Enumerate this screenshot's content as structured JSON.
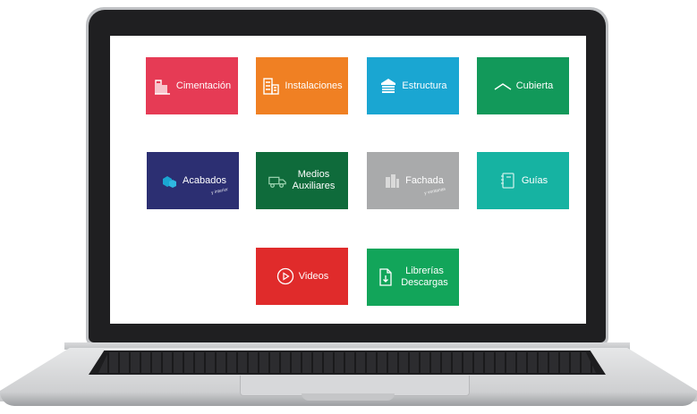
{
  "tiles": [
    {
      "id": "cimentacion",
      "label": "Cimentación",
      "color": "#e63b55",
      "icon": "columns-icon"
    },
    {
      "id": "instalaciones",
      "label": "Instalaciones",
      "color": "#f08023",
      "icon": "building-icon"
    },
    {
      "id": "estructura",
      "label": "Estructura",
      "color": "#1aa6d2",
      "icon": "stack-icon"
    },
    {
      "id": "cubierta",
      "label": "Cubierta",
      "color": "#12995a",
      "icon": "roof-icon"
    },
    {
      "id": "acabados",
      "label": "Acabados",
      "sublabel": "y interior",
      "color": "#2c2f72",
      "icon": "cubes-icon"
    },
    {
      "id": "medios",
      "label": "Medios Auxiliares",
      "color": "#0f6b3b",
      "icon": "truck-icon"
    },
    {
      "id": "fachada",
      "label": "Fachada",
      "sublabel": "y ventanas",
      "color": "#a9aaab",
      "icon": "facade-icon"
    },
    {
      "id": "guias",
      "label": "Guías",
      "color": "#16b3a2",
      "icon": "notebook-icon"
    },
    {
      "id": "videos",
      "label": "Videos",
      "color": "#e02b2b",
      "icon": "play-icon"
    },
    {
      "id": "librerias",
      "label": "Librerías Descargas",
      "color": "#12a55a",
      "icon": "download-file-icon"
    }
  ]
}
